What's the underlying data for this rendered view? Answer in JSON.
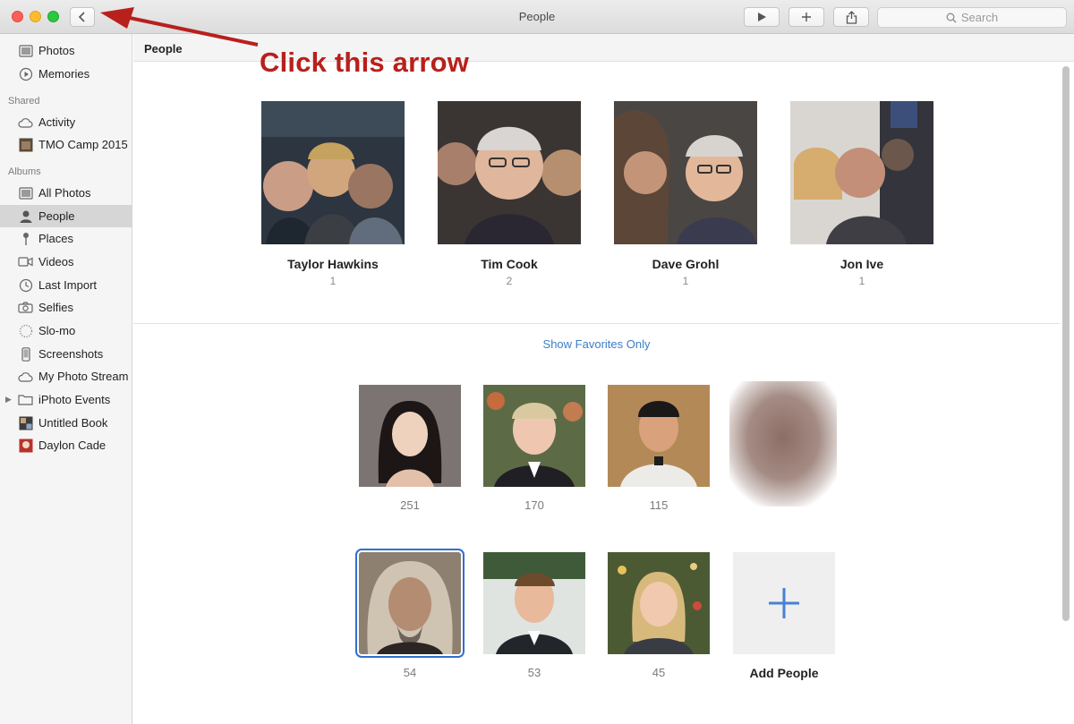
{
  "window": {
    "title": "People"
  },
  "toolbar": {
    "search_placeholder": "Search",
    "back_icon": "chevron-left-icon",
    "play_icon": "play-icon",
    "add_icon": "plus-icon",
    "share_icon": "share-icon"
  },
  "sidebar": {
    "library": [
      {
        "label": "Photos",
        "icon": "photos-icon"
      },
      {
        "label": "Memories",
        "icon": "memories-icon"
      }
    ],
    "shared_header": "Shared",
    "shared": [
      {
        "label": "Activity",
        "icon": "cloud-icon"
      },
      {
        "label": "TMO Camp 2015",
        "icon": "album-thumbnail-icon"
      }
    ],
    "albums_header": "Albums",
    "albums": [
      {
        "label": "All Photos",
        "icon": "photos-icon"
      },
      {
        "label": "People",
        "icon": "person-icon",
        "selected": true
      },
      {
        "label": "Places",
        "icon": "pin-icon"
      },
      {
        "label": "Videos",
        "icon": "video-icon"
      },
      {
        "label": "Last Import",
        "icon": "clock-icon"
      },
      {
        "label": "Selfies",
        "icon": "camera-icon"
      },
      {
        "label": "Slo-mo",
        "icon": "slomo-icon"
      },
      {
        "label": "Screenshots",
        "icon": "phone-icon"
      },
      {
        "label": "My Photo Stream",
        "icon": "cloud-icon"
      },
      {
        "label": "iPhoto Events",
        "icon": "folder-icon"
      },
      {
        "label": "Untitled Book",
        "icon": "book-icon"
      },
      {
        "label": "Daylon Cade",
        "icon": "album-thumbnail-icon"
      }
    ]
  },
  "content": {
    "title": "People",
    "favorites": [
      {
        "name": "Taylor Hawkins",
        "count": "1"
      },
      {
        "name": "Tim Cook",
        "count": "2"
      },
      {
        "name": "Dave Grohl",
        "count": "1"
      },
      {
        "name": "Jon Ive",
        "count": "1"
      }
    ],
    "show_favorites_link": "Show Favorites Only",
    "people": [
      {
        "count": "251"
      },
      {
        "count": "170"
      },
      {
        "count": "115"
      },
      {
        "count": ""
      },
      {
        "count": "54",
        "selected": true
      },
      {
        "count": "53"
      },
      {
        "count": "45"
      }
    ],
    "add_people_label": "Add People"
  },
  "annotation": {
    "text": "Click this arrow",
    "color": "#b8201c"
  }
}
